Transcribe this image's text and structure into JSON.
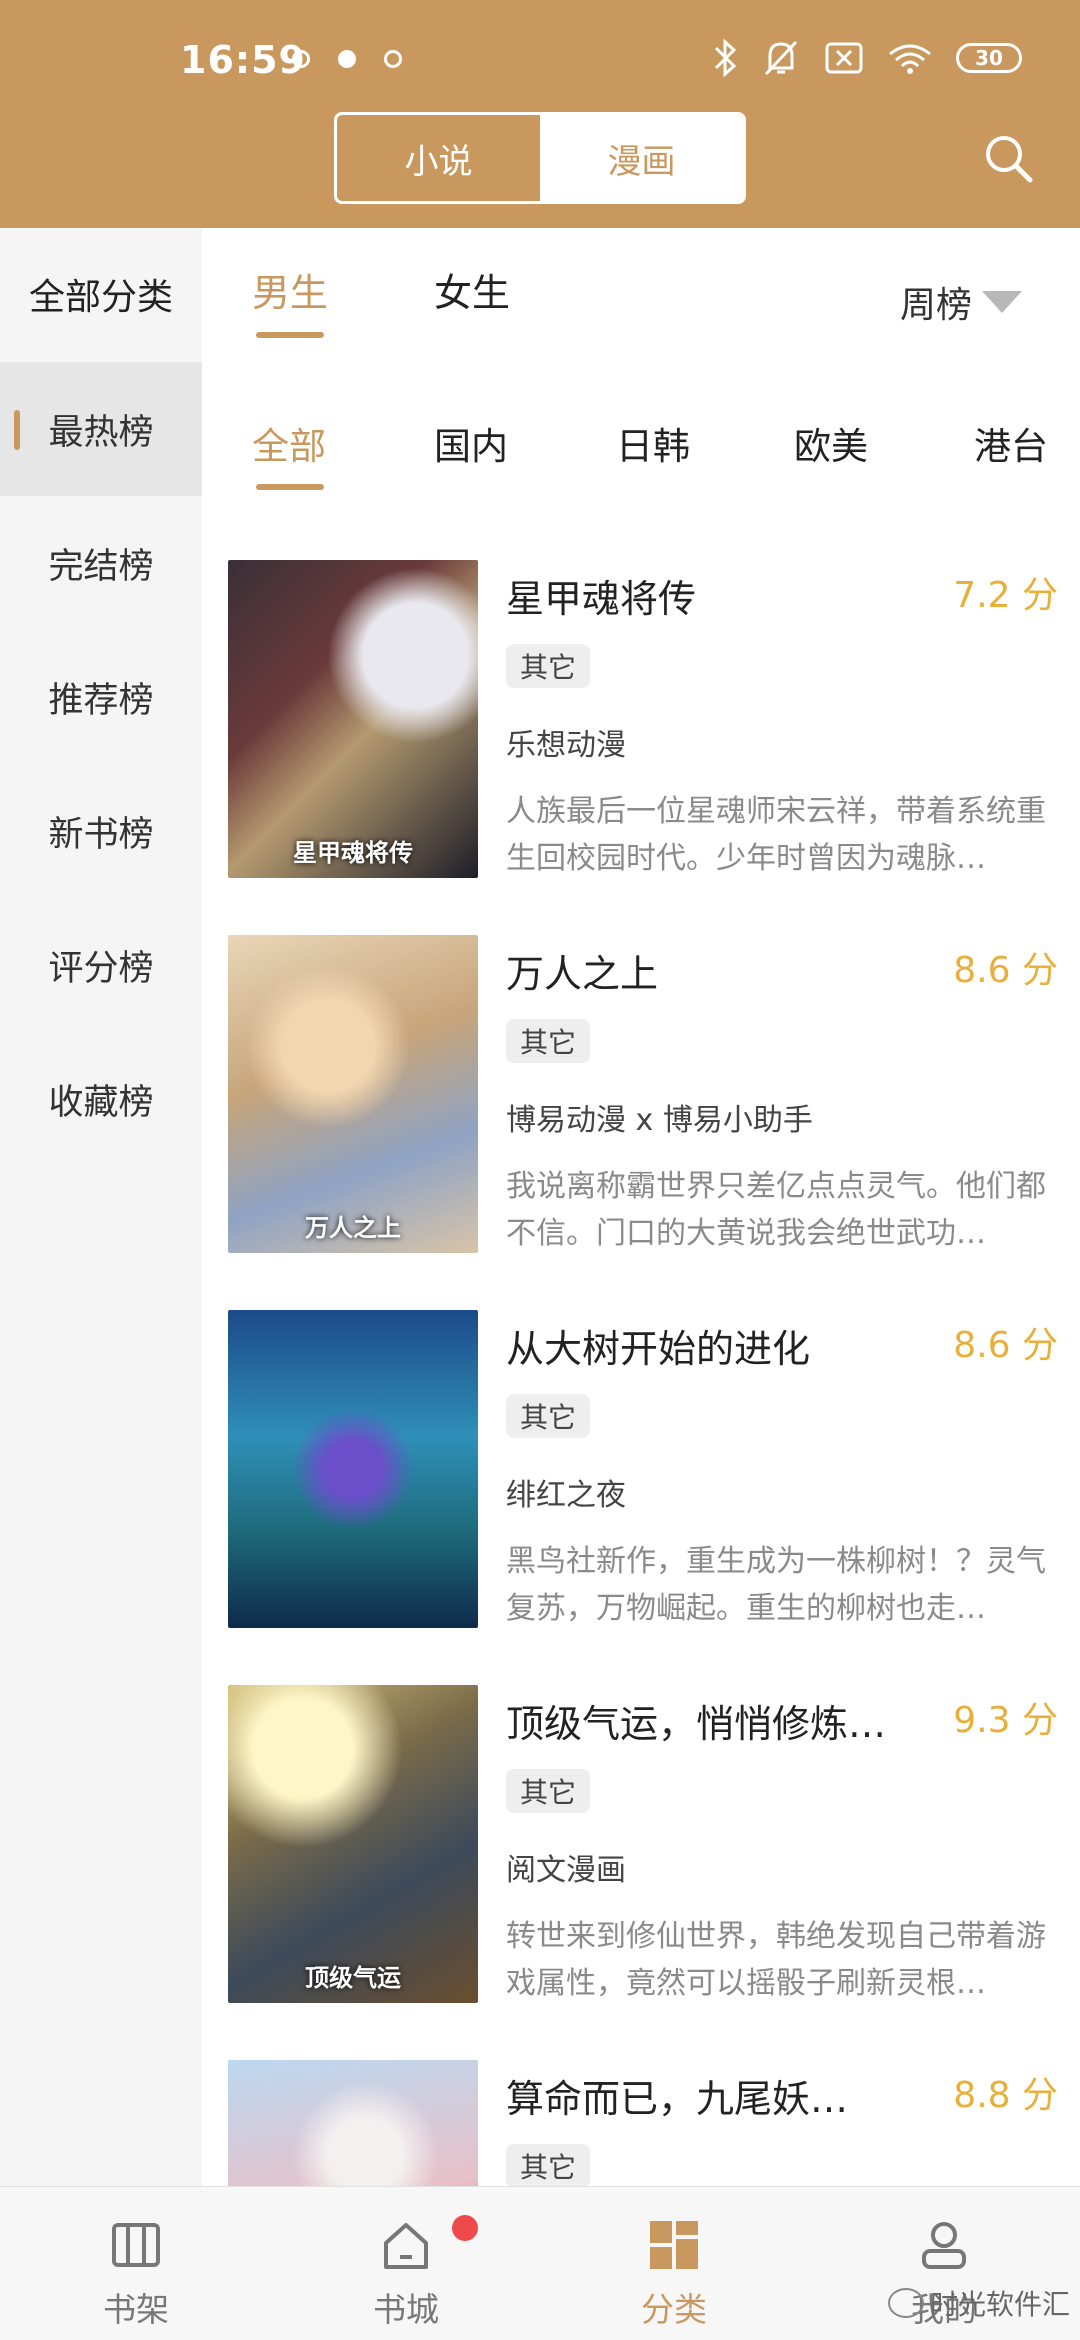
{
  "status_bar": {
    "time": "16:59",
    "battery": "30"
  },
  "header": {
    "tabs": [
      {
        "label": "小说",
        "active": false
      },
      {
        "label": "漫画",
        "active": true
      }
    ],
    "search_icon": "search-icon",
    "accent_color": "#c9985f"
  },
  "sidebar": {
    "title": "全部分类",
    "items": [
      {
        "label": "最热榜",
        "active": true
      },
      {
        "label": "完结榜",
        "active": false
      },
      {
        "label": "推荐榜",
        "active": false
      },
      {
        "label": "新书榜",
        "active": false
      },
      {
        "label": "评分榜",
        "active": false
      },
      {
        "label": "收藏榜",
        "active": false
      }
    ]
  },
  "gender_tabs": [
    {
      "label": "男生",
      "active": true
    },
    {
      "label": "女生",
      "active": false
    }
  ],
  "rank_period": "周榜",
  "region_tabs": [
    {
      "label": "全部",
      "active": true
    },
    {
      "label": "国内",
      "active": false
    },
    {
      "label": "日韩",
      "active": false
    },
    {
      "label": "欧美",
      "active": false
    },
    {
      "label": "港台",
      "active": false
    }
  ],
  "books": [
    {
      "title": "星甲魂将传",
      "score": "7.2 分",
      "tag": "其它",
      "author": "乐想动漫",
      "desc": "人族最后一位星魂师宋云祥，带着系统重生回校园时代。少年时曾因为魂脉…",
      "cover_caption": "星甲魂将传"
    },
    {
      "title": "万人之上",
      "score": "8.6 分",
      "tag": "其它",
      "author": "博易动漫 x 博易小助手",
      "desc": "我说离称霸世界只差亿点点灵气。他们都不信。门口的大黄说我会绝世武功…",
      "cover_caption": "万人之上"
    },
    {
      "title": "从大树开始的进化",
      "score": "8.6 分",
      "tag": "其它",
      "author": "绯红之夜",
      "desc": "黑鸟社新作，重生成为一株柳树！？灵气复苏，万物崛起。重生的柳树也走…",
      "cover_caption": ""
    },
    {
      "title": "顶级气运，悄悄修炼…",
      "score": "9.3 分",
      "tag": "其它",
      "author": "阅文漫画",
      "desc": "转世来到修仙世界，韩绝发现自己带着游戏属性，竟然可以摇骰子刷新灵根…",
      "cover_caption": "顶级气运"
    },
    {
      "title": "算命而已，九尾妖…",
      "score": "8.8 分",
      "tag": "其它",
      "author": "",
      "desc": "",
      "cover_caption": ""
    }
  ],
  "bottom_nav": [
    {
      "label": "书架",
      "icon": "bookshelf-icon",
      "active": false
    },
    {
      "label": "书城",
      "icon": "home-icon",
      "active": false,
      "badge": true
    },
    {
      "label": "分类",
      "icon": "category-grid-icon",
      "active": true
    },
    {
      "label": "我的",
      "icon": "profile-icon",
      "active": false
    }
  ],
  "watermark": "时光软件汇"
}
